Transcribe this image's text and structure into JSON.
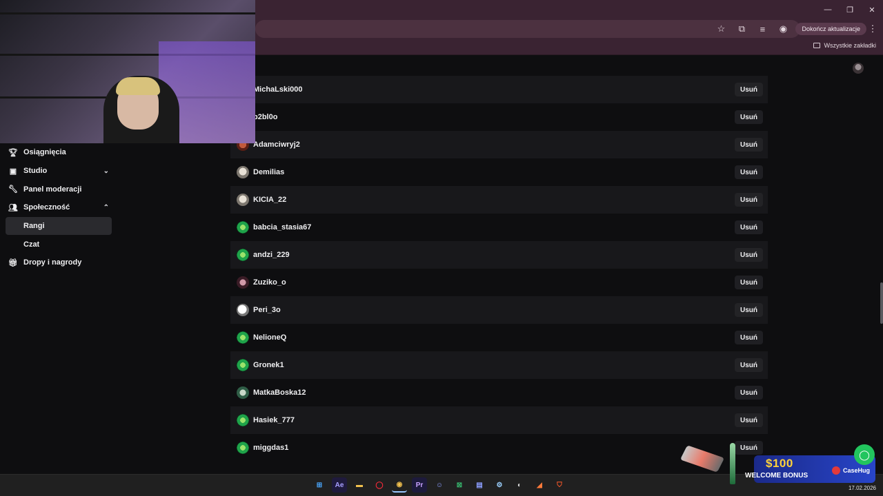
{
  "browser": {
    "update_button": "Dokończ aktualizacje",
    "bookmarks_all": "Wszystkie zakładki"
  },
  "sidebar": {
    "items": [
      {
        "label": "Osiągnięcia",
        "icon": "trophy-icon"
      },
      {
        "label": "Studio",
        "icon": "studio-icon",
        "chevron": "down"
      },
      {
        "label": "Panel moderacji",
        "icon": "wrench-icon"
      },
      {
        "label": "Społeczność",
        "icon": "community-icon",
        "chevron": "up"
      }
    ],
    "subitems": [
      {
        "label": "Rangi",
        "active": true
      },
      {
        "label": "Czat",
        "active": false
      }
    ],
    "last_item": {
      "label": "Dropy i nagrody",
      "icon": "gift-icon"
    }
  },
  "list": {
    "remove_label": "Usuń",
    "rows": [
      {
        "name": "MichaLski000",
        "avatar": "none"
      },
      {
        "name": "b2bl0o",
        "avatar": "none"
      },
      {
        "name": "Adamciwryj2",
        "avatar": "red"
      },
      {
        "name": "Demilias",
        "avatar": "gray"
      },
      {
        "name": "KICIA_22",
        "avatar": "gray"
      },
      {
        "name": "babcia_stasia67",
        "avatar": "green"
      },
      {
        "name": "andzi_229",
        "avatar": "green"
      },
      {
        "name": "Zuziko_o",
        "avatar": "pink"
      },
      {
        "name": "Peri_3o",
        "avatar": "white"
      },
      {
        "name": "NelioneQ",
        "avatar": "green"
      },
      {
        "name": "Gronek1",
        "avatar": "green"
      },
      {
        "name": "MatkaBoska12",
        "avatar": "mixed"
      },
      {
        "name": "Hasiek_777",
        "avatar": "green"
      },
      {
        "name": "miggdas1",
        "avatar": "green"
      }
    ]
  },
  "ad": {
    "amount": "$100",
    "bonus": "WELCOME BONUS",
    "brand": "CaseHug"
  },
  "taskbar": {
    "date": "17.02.2026",
    "apps": [
      "windows",
      "Ae",
      "folder",
      "opera",
      "chrome",
      "Pr",
      "discord",
      "excel",
      "app",
      "steam",
      "app2",
      "app3",
      "brave"
    ]
  }
}
